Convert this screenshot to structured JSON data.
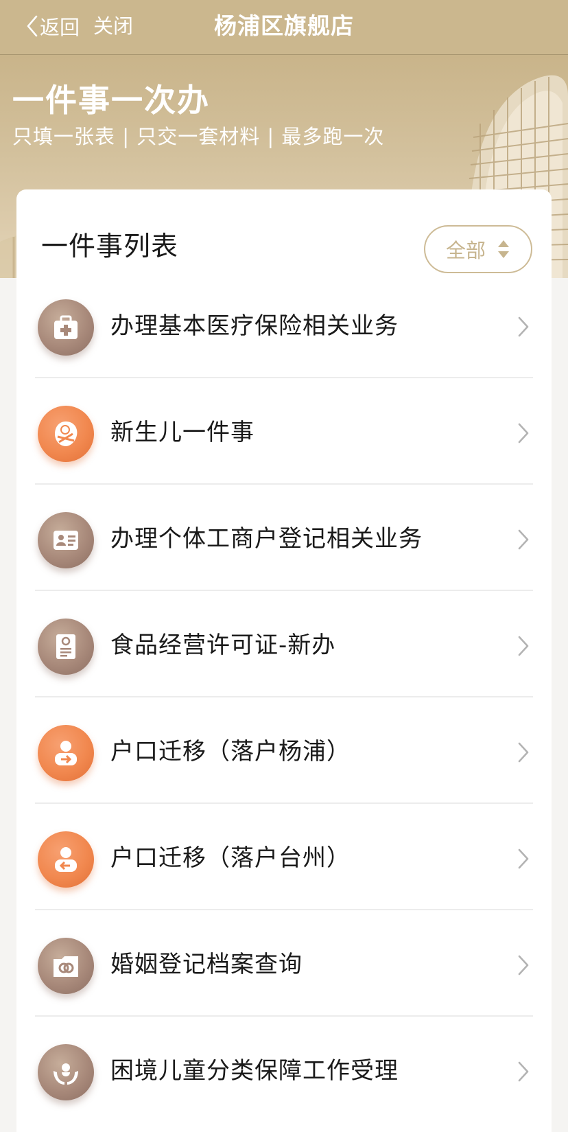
{
  "nav": {
    "back_label": "返回",
    "close_label": "关闭",
    "title": "杨浦区旗舰店"
  },
  "hero": {
    "title": "一件事一次办",
    "subtitle": "只填一张表 | 只交一套材料 | 最多跑一次"
  },
  "card": {
    "title": "一件事列表",
    "filter_label": "全部"
  },
  "items": [
    {
      "label": "办理基本医疗保险相关业务",
      "icon": "medical-kit-icon",
      "color": "brown"
    },
    {
      "label": "新生儿一件事",
      "icon": "newborn-baby-icon",
      "color": "orange"
    },
    {
      "label": "办理个体工商户登记相关业务",
      "icon": "id-card-icon",
      "color": "brown"
    },
    {
      "label": "食品经营许可证-新办",
      "icon": "certificate-icon",
      "color": "brown"
    },
    {
      "label": "户口迁移（落户杨浦）",
      "icon": "person-move-in-icon",
      "color": "orange"
    },
    {
      "label": "户口迁移（落户台州）",
      "icon": "person-move-out-icon",
      "color": "orange"
    },
    {
      "label": "婚姻登记档案查询",
      "icon": "marriage-folder-icon",
      "color": "brown"
    },
    {
      "label": "困境儿童分类保障工作受理",
      "icon": "child-hands-icon",
      "color": "brown"
    }
  ],
  "colors": {
    "nav_bg": "#cbb78e",
    "accent_gold": "#c7b58f",
    "icon_brown": "#a8897a",
    "icon_orange": "#f1884f"
  }
}
